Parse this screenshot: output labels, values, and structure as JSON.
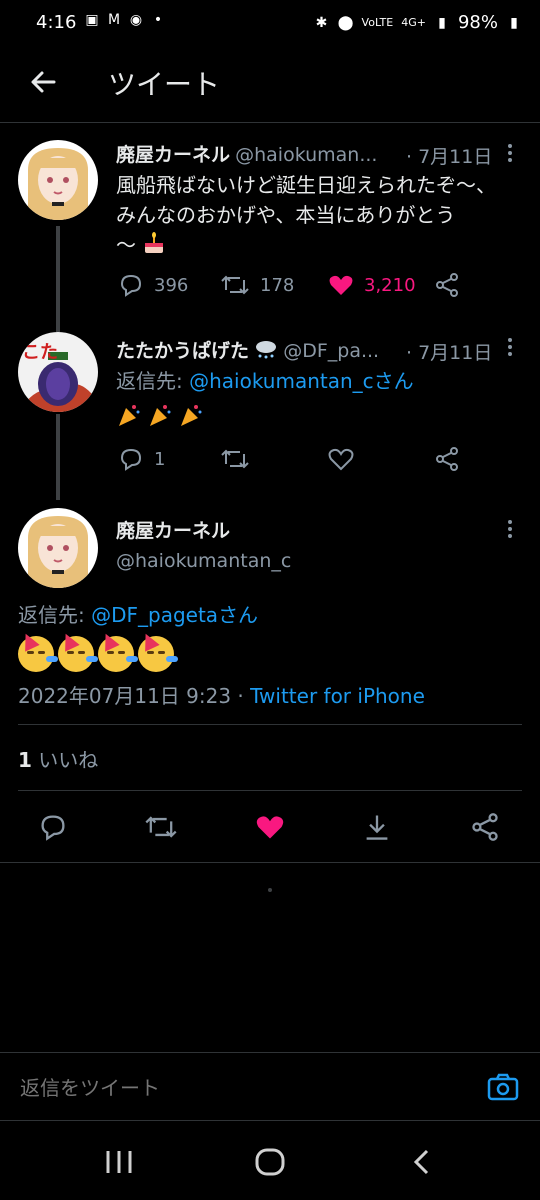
{
  "status_bar": {
    "time": "4:16",
    "battery": "98%",
    "network": "4G+"
  },
  "header": {
    "title": "ツイート"
  },
  "tweets": [
    {
      "name": "廃屋カーネル",
      "handle": "@haiokuman...",
      "date": "· 7月11日",
      "text_line1": "風船飛ばないけど誕生日迎えられたぞ〜、",
      "text_line2": "みんなのおかげや、本当にありがとう",
      "text_line3": "〜",
      "replies": "396",
      "retweets": "178",
      "likes": "3,210"
    },
    {
      "name": "たたかうぱげた",
      "handle": "@DF_pa...",
      "date": "· 7月11日",
      "reply_prefix": "返信先: ",
      "reply_to": "@haiokumantan_cさん",
      "replies": "1"
    }
  ],
  "main_tweet": {
    "name": "廃屋カーネル",
    "handle": "@haiokumantan_c",
    "reply_prefix": "返信先: ",
    "reply_to": "@DF_pagetaさん",
    "timestamp": "2022年07月11日 9:23 · ",
    "client": "Twitter for iPhone",
    "likes_count": "1",
    "likes_label": " いいね"
  },
  "compose": {
    "placeholder": "返信をツイート"
  },
  "colors": {
    "accent": "#1d9bf0",
    "like": "#f91880",
    "background": "#000000"
  }
}
